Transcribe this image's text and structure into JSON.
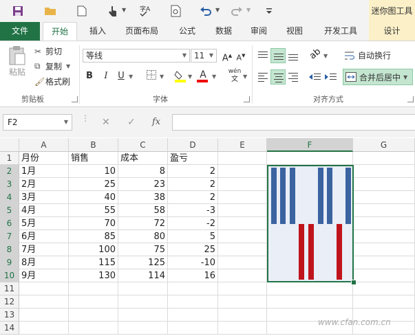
{
  "qat": {
    "icons": [
      "save-icon",
      "open-folder-icon",
      "new-file-icon",
      "touch-mode-icon",
      "spell-check-icon",
      "print-preview-icon",
      "undo-icon",
      "redo-icon",
      "customize-icon"
    ]
  },
  "context": {
    "title": "迷你图工具"
  },
  "tabs": [
    "文件",
    "开始",
    "插入",
    "页面布局",
    "公式",
    "数据",
    "审阅",
    "视图",
    "开发工具",
    "设计"
  ],
  "ribbon": {
    "clipboard": {
      "paste": "粘贴",
      "cut": "剪切",
      "copy": "复制",
      "format_painter": "格式刷",
      "label": "剪贴板"
    },
    "font": {
      "name": "等线",
      "size": "11",
      "grow": "A",
      "shrink": "A",
      "bold": "B",
      "italic": "I",
      "underline": "U",
      "wen": "wén",
      "wen_sub": "文",
      "label": "字体"
    },
    "alignment": {
      "wrap": "自动换行",
      "merge": "合并后居中",
      "label": "对齐方式"
    }
  },
  "formula_bar": {
    "name_box": "F2",
    "fx": "fx",
    "value": ""
  },
  "sheet": {
    "columns": [
      "A",
      "B",
      "C",
      "D",
      "E",
      "F",
      "G"
    ],
    "active_column": "F",
    "rows": [
      "1",
      "2",
      "3",
      "4",
      "5",
      "6",
      "7",
      "8",
      "9",
      "10",
      "11",
      "12",
      "13",
      "14"
    ],
    "header_row": [
      "月份",
      "销售",
      "成本",
      "盈亏"
    ],
    "data": [
      [
        "1月",
        "10",
        "8",
        "2"
      ],
      [
        "2月",
        "25",
        "23",
        "2"
      ],
      [
        "3月",
        "40",
        "38",
        "2"
      ],
      [
        "4月",
        "55",
        "58",
        "-3"
      ],
      [
        "5月",
        "70",
        "72",
        "-2"
      ],
      [
        "6月",
        "85",
        "80",
        "5"
      ],
      [
        "7月",
        "100",
        "75",
        "25"
      ],
      [
        "8月",
        "115",
        "125",
        "-10"
      ],
      [
        "9月",
        "130",
        "114",
        "16"
      ]
    ]
  },
  "sparkline": {
    "type": "win-loss",
    "values": [
      2,
      2,
      2,
      -3,
      -2,
      5,
      25,
      -10,
      16
    ],
    "positive_color": "#3a63a0",
    "negative_color": "#c0141c",
    "background": "#e9eef7"
  },
  "watermark": "www.cfan.com.cn",
  "colors": {
    "accent": "#217346"
  }
}
